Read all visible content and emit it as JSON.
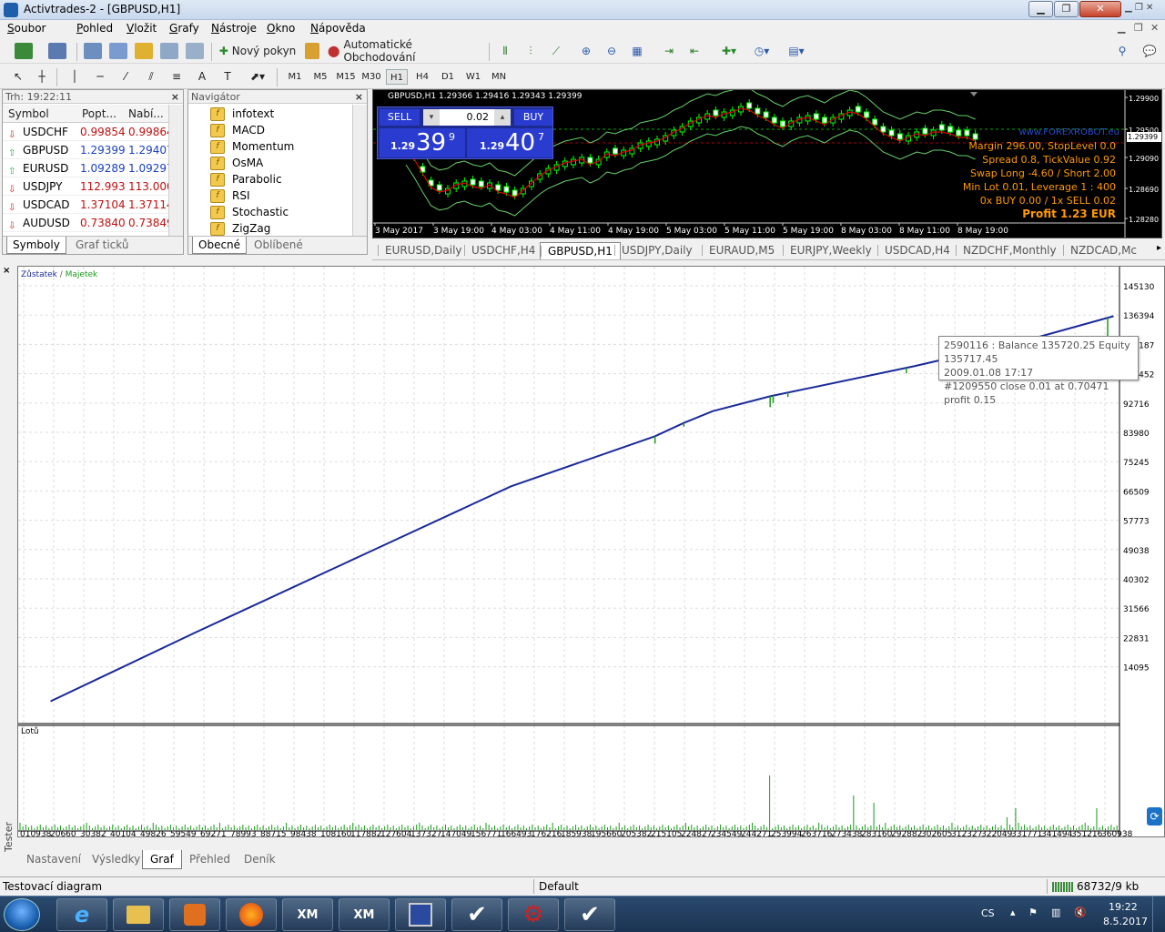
{
  "window": {
    "title": "Activtrades-2 - [GBPUSD,H1]",
    "btn_min": "▁",
    "btn_max": "❐",
    "btn_close": "✕"
  },
  "menu": [
    "Soubor",
    "Pohled",
    "Vložit",
    "Grafy",
    "Nástroje",
    "Okno",
    "Nápověda"
  ],
  "toolbar": {
    "new_order": "Nový pokyn",
    "auto_trading": "Automatické Obchodování",
    "timeframes": [
      "M1",
      "M5",
      "M15",
      "M30",
      "H1",
      "H4",
      "D1",
      "W1",
      "MN"
    ],
    "active_timeframe": "H1"
  },
  "market_watch": {
    "header": "Trh: 19:22:11",
    "close": "×",
    "columns": [
      "Symbol",
      "Popt...",
      "Nabí..."
    ],
    "rows": [
      {
        "symbol": "USDCHF",
        "ask": "0.99854",
        "bid": "0.99864",
        "dir": "dn"
      },
      {
        "symbol": "GBPUSD",
        "ask": "1.29399",
        "bid": "1.29407",
        "dir": "up"
      },
      {
        "symbol": "EURUSD",
        "ask": "1.09289",
        "bid": "1.09297",
        "dir": "up"
      },
      {
        "symbol": "USDJPY",
        "ask": "112.993",
        "bid": "113.000",
        "dir": "dn"
      },
      {
        "symbol": "USDCAD",
        "ask": "1.37104",
        "bid": "1.37114",
        "dir": "dn"
      },
      {
        "symbol": "AUDUSD",
        "ask": "0.73840",
        "bid": "0.73849",
        "dir": "dn"
      }
    ],
    "tabs": [
      "Symboly",
      "Graf ticků"
    ]
  },
  "navigator": {
    "header": "Navigátor",
    "close": "×",
    "items": [
      "infotext",
      "MACD",
      "Momentum",
      "OsMA",
      "Parabolic",
      "RSI",
      "Stochastic",
      "ZigZag"
    ],
    "tabs": [
      "Obecné",
      "Oblíbené"
    ]
  },
  "chart": {
    "header": "GBPUSD,H1  1.29366 1.29416 1.29343 1.29399",
    "sell_label": "SELL",
    "buy_label": "BUY",
    "lot": "0.02",
    "sell_big": "39",
    "sell_sup": "9",
    "sell_small": "1.29",
    "buy_big": "40",
    "buy_sup": "7",
    "buy_small": "1.29",
    "watermark": "www.FOREXROBOT.eu",
    "info": [
      "Margin 296.00, StopLevel 0.0",
      "Spread 0.8, TickValue 0.92",
      "Swap Long -4.60 / Short 2.00",
      "Min Lot 0.01, Leverage 1 : 400",
      "0x BUY 0.00 / 1x SELL 0.02"
    ],
    "profit": "Profit 1.23 EUR",
    "price_ticks": [
      "1.29900",
      "1.29500",
      "1.29399",
      "1.29090",
      "1.28690",
      "1.28280"
    ],
    "time_ticks": [
      "3 May 2017",
      "3 May 19:00",
      "4 May 03:00",
      "4 May 11:00",
      "4 May 19:00",
      "5 May 03:00",
      "5 May 11:00",
      "5 May 19:00",
      "8 May 03:00",
      "8 May 11:00",
      "8 May 19:00"
    ],
    "accent_up": "#00ff00",
    "accent_dn": "#ff0000"
  },
  "chart_tabs": [
    "EURUSD,Daily",
    "USDCHF,H4",
    "GBPUSD,H1",
    "USDJPY,Daily",
    "EURAUD,M5",
    "EURJPY,Weekly",
    "USDCAD,H4",
    "NZDCHF,Monthly",
    "NZDCAD,Mc"
  ],
  "chart_tabs_selected": "GBPUSD,H1",
  "tester": {
    "side_label": "Tester",
    "legend_balance": "Zůstatek",
    "legend_sep": " / ",
    "legend_equity": "Majetek",
    "lots_label": "Lotů",
    "tooltip": [
      "2590116 : Balance 135720.25 Equity 135717.45",
      "2009.01.08 17:17",
      "#1209550 close 0.01 at 0.70471 profit 0.15"
    ],
    "tabs": [
      "Nastavení",
      "Výsledky",
      "Graf",
      "Přehled",
      "Deník"
    ],
    "selected_tab": "Graf"
  },
  "chart_data": {
    "type": "line",
    "series": [
      {
        "name": "Zůstatek",
        "x": [
          10938,
          59549,
          117882,
          166493,
          215105,
          224827,
          234549,
          253994,
          302605,
          341494,
          370000
        ],
        "values": [
          20500,
          41000,
          65000,
          85000,
          100000,
          104000,
          107500,
          112000,
          121000,
          129000,
          136000
        ]
      }
    ],
    "x_ticks": [
      "010938",
      "20660",
      "30382",
      "40104",
      "49826",
      "59549",
      "69271",
      "78993",
      "88715",
      "98438",
      "108160",
      "117882",
      "127604",
      "137327",
      "147049",
      "156771",
      "166493",
      "176216",
      "185938",
      "195660",
      "205382",
      "215105",
      "224827",
      "234549",
      "244271",
      "253994",
      "263716",
      "273438",
      "283160",
      "292882",
      "302605",
      "312327",
      "322049",
      "331771",
      "341494",
      "351216",
      "360938"
    ],
    "y_ticks": [
      "145130",
      "136394",
      "110187",
      "101452",
      "92716",
      "83980",
      "75245",
      "66509",
      "57773",
      "49038",
      "40302",
      "31566",
      "22831",
      "14095"
    ],
    "ylim": [
      14095,
      145130
    ]
  },
  "status": {
    "left": "Testovací diagram",
    "profile": "Default",
    "traffic": "68732/9 kb"
  },
  "taskbar": {
    "lang": "CS",
    "time": "19:22",
    "date": "8.5.2017",
    "apps": [
      "XM",
      "XM"
    ]
  }
}
